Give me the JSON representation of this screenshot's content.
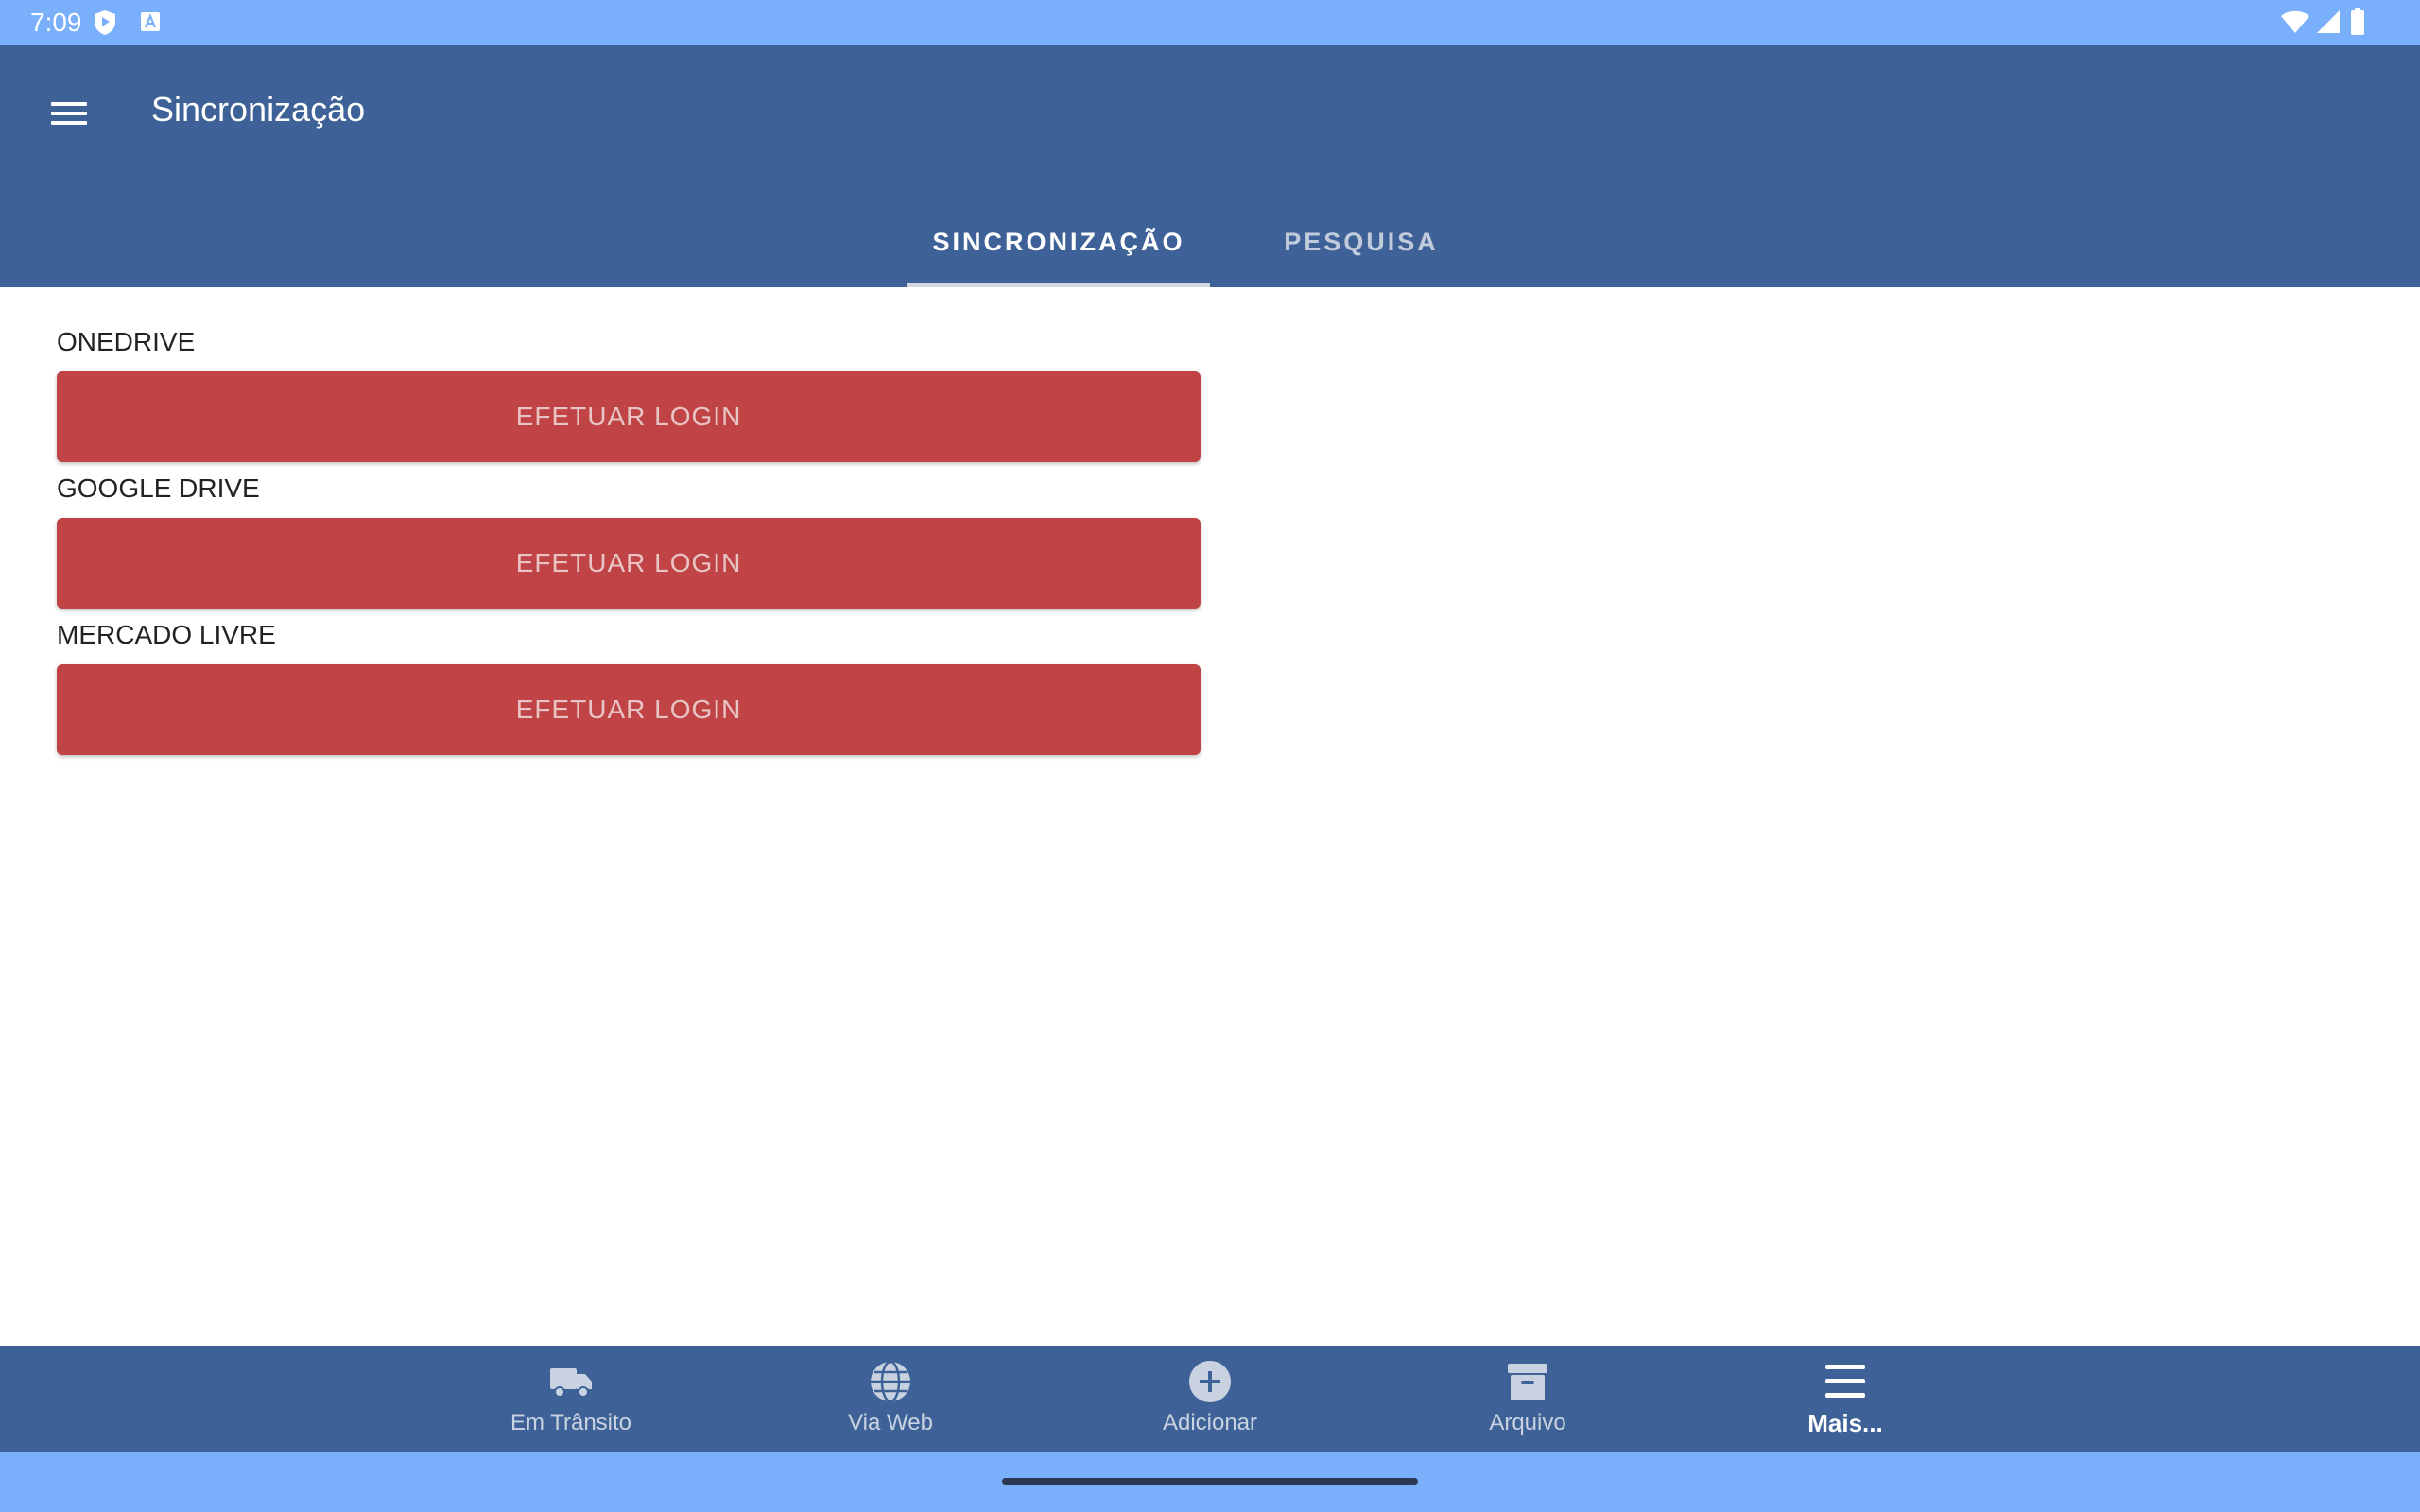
{
  "status_bar": {
    "time": "7:09"
  },
  "app_bar": {
    "title": "Sincronização"
  },
  "tabs": [
    {
      "label": "SINCRONIZAÇÃO",
      "active": true
    },
    {
      "label": "PESQUISA",
      "active": false
    }
  ],
  "sections": [
    {
      "label": "ONEDRIVE",
      "button": "EFETUAR LOGIN"
    },
    {
      "label": "GOOGLE DRIVE",
      "button": "EFETUAR LOGIN"
    },
    {
      "label": "MERCADO LIVRE",
      "button": "EFETUAR LOGIN"
    }
  ],
  "bottom_nav": [
    {
      "label": "Em Trânsito",
      "icon": "truck-icon"
    },
    {
      "label": "Via Web",
      "icon": "globe-icon"
    },
    {
      "label": "Adicionar",
      "icon": "add-circle-icon"
    },
    {
      "label": "Arquivo",
      "icon": "archive-icon"
    },
    {
      "label": "Mais...",
      "icon": "menu-icon",
      "active": true
    }
  ],
  "colors": {
    "status_bar": "#7aaffc",
    "app_bar": "#3e6297",
    "button": "#c04445"
  }
}
